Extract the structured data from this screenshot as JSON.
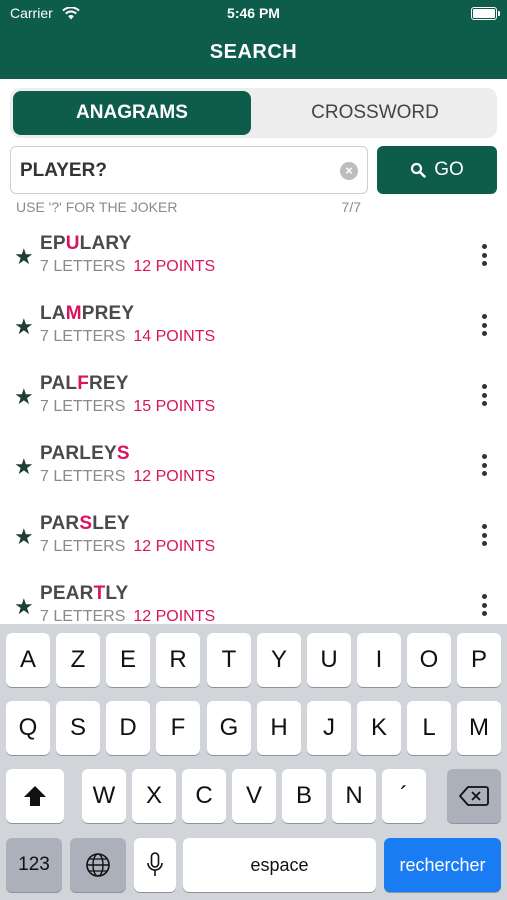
{
  "status": {
    "carrier": "Carrier",
    "time": "5:46 PM"
  },
  "header": {
    "title": "SEARCH"
  },
  "tabs": [
    {
      "label": "ANAGRAMS"
    },
    {
      "label": "CROSSWORD"
    }
  ],
  "search": {
    "value": "PLAYER?",
    "go_label": "GO",
    "hint": "USE '?' FOR THE JOKER",
    "count": "7/7"
  },
  "results": [
    {
      "pre": "EP",
      "hl": "U",
      "post": "LARY",
      "letters": "7 LETTERS",
      "points": "12 POINTS"
    },
    {
      "pre": "LA",
      "hl": "M",
      "post": "PREY",
      "letters": "7 LETTERS",
      "points": "14 POINTS"
    },
    {
      "pre": "PAL",
      "hl": "F",
      "post": "REY",
      "letters": "7 LETTERS",
      "points": "15 POINTS"
    },
    {
      "pre": "PARLEY",
      "hl": "S",
      "post": "",
      "letters": "7 LETTERS",
      "points": "12 POINTS"
    },
    {
      "pre": "PAR",
      "hl": "S",
      "post": "LEY",
      "letters": "7 LETTERS",
      "points": "12 POINTS"
    },
    {
      "pre": "PEAR",
      "hl": "T",
      "post": "LY",
      "letters": "7 LETTERS",
      "points": "12 POINTS"
    }
  ],
  "keyboard": {
    "row1": [
      "A",
      "Z",
      "E",
      "R",
      "T",
      "Y",
      "U",
      "I",
      "O",
      "P"
    ],
    "row2": [
      "Q",
      "S",
      "D",
      "F",
      "G",
      "H",
      "J",
      "K",
      "L",
      "M"
    ],
    "row3": [
      "W",
      "X",
      "C",
      "V",
      "B",
      "N",
      "´"
    ],
    "numbers": "123",
    "space": "espace",
    "return": "rechercher"
  },
  "colors": {
    "brand": "#0e5c4a",
    "accent": "#d8145e",
    "keyboard_blue": "#1a7cf2"
  }
}
